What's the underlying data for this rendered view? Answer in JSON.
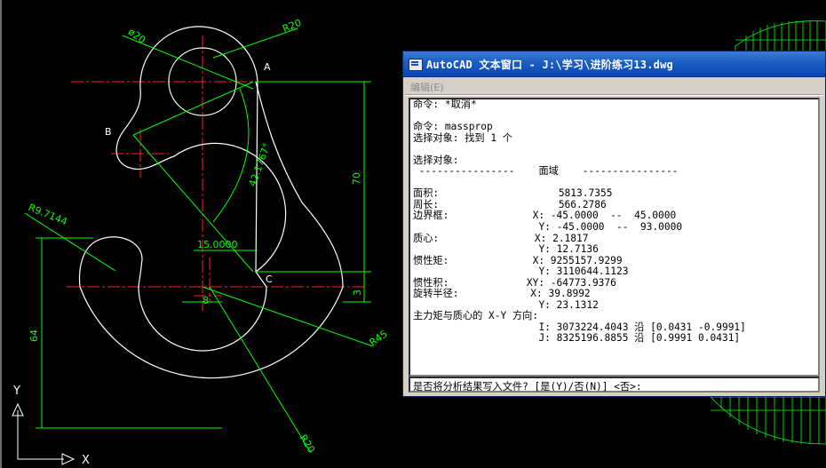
{
  "drawing": {
    "label_a": "A",
    "label_b": "B",
    "label_c": "C",
    "dim_phi20": "ø20",
    "dim_r20_top": "R20",
    "dim_r9": "R9.7144",
    "dim_angle": "42.1767°",
    "dim_15": "15.0000",
    "dim_70": "70",
    "dim_3": "3",
    "dim_64": "64",
    "dim_8": "8",
    "dim_r45": "R45",
    "dim_r20_bottom": "R20",
    "ucs_x": "X",
    "ucs_y": "Y"
  },
  "window": {
    "title": "AutoCAD 文本窗口 - J:\\学习\\进阶练习13.dwg",
    "menu_edit": "编辑(E)",
    "history": "命令: *取消*\n\n命令: massprop\n选择对象: 找到 1 个\n\n选择对象:\n ----------------    面域    ----------------\n\n面积:                    5813.7355\n周长:                    566.2786\n边界框:              X: -45.0000  --  45.0000\n                     Y: -45.0000  --  93.0000\n质心:                X: 2.1817\n                     Y: 12.7136\n惯性矩:              X: 9255157.9299\n                     Y: 3110644.1123\n惯性积:             XY: -64773.9376\n旋转半径:            X: 39.8992\n                     Y: 23.1312\n主力矩与质心的 X-Y 方向:\n                     I: 3073224.4043 沿 [0.0431 -0.9991]\n                     J: 8325196.8855 沿 [0.9991 0.0431]",
    "command_line": "是否将分析结果写入文件? [是(Y)/否(N)] <否>:"
  },
  "colors": {
    "background": "#000000",
    "outline": "#ffffff",
    "centerline": "#ff2020",
    "dimension": "#00ff00",
    "titlebar": "#0a46b8"
  }
}
